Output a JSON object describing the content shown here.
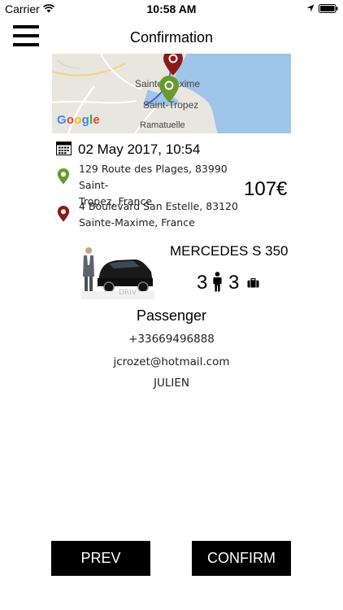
{
  "status_bar": {
    "carrier": "Carrier",
    "time": "10:58 AM"
  },
  "header": {
    "title": "Confirmation",
    "menu_icon": "hamburger-menu-icon"
  },
  "map": {
    "labels": {
      "city_1": "Sainte-Maxime",
      "city_2": "Saint-Tropez",
      "city_3": "Ramatuelle"
    },
    "logo": "Google",
    "pickup_marker_color": "#6a9a2f",
    "dropoff_marker_color": "#8b1a1a"
  },
  "booking": {
    "datetime": "02 May 2017, 10:54",
    "pickup_line_1": "129 Route des Plages, 83990 Saint-",
    "pickup_line_2": "Tropez, France",
    "dropoff_line_1": "4 Boulevard San Estelle, 83120",
    "dropoff_line_2": "Sainte-Maxime, France",
    "price": "107€"
  },
  "vehicle": {
    "name": "MERCEDES S 350",
    "passengers": "3",
    "luggage": "3",
    "watermark": "DRIV"
  },
  "passenger": {
    "heading": "Passenger",
    "phone": "+33669496888",
    "email": "jcrozet@hotmail.com",
    "name": "JULIEN"
  },
  "buttons": {
    "prev": "PREV",
    "confirm": "CONFIRM"
  }
}
